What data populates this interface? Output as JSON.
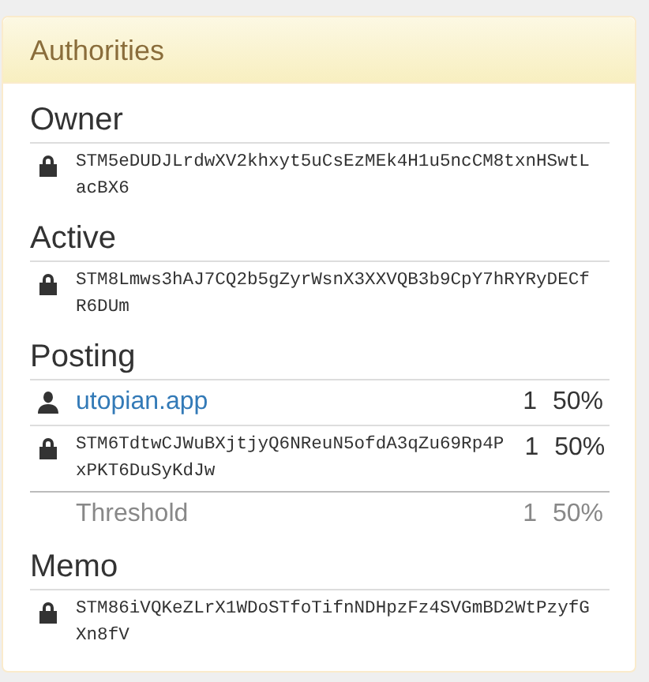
{
  "panel": {
    "title": "Authorities"
  },
  "sections": [
    {
      "title": "Owner",
      "entries": [
        {
          "kind": "key",
          "text": "STM5eDUDJLrdwXV2khxyt5uCsEzMEk4H1u5ncCM8txnHSwtLacBX6"
        }
      ]
    },
    {
      "title": "Active",
      "entries": [
        {
          "kind": "key",
          "text": "STM8Lmws3hAJ7CQ2b5gZyrWsnX3XXVQB3b9CpY7hRYRyDECfR6DUm"
        }
      ]
    },
    {
      "title": "Posting",
      "entries": [
        {
          "kind": "account",
          "text": "utopian.app",
          "weight": "1",
          "percent": "50%"
        },
        {
          "kind": "key",
          "text": "STM6TdtwCJWuBXjtjyQ6NReuN5ofdA3qZu69Rp4PxPKT6DuSyKdJw",
          "weight": "1",
          "percent": "50%"
        }
      ],
      "threshold": {
        "label": "Threshold",
        "weight": "1",
        "percent": "50%"
      }
    },
    {
      "title": "Memo",
      "entries": [
        {
          "kind": "key",
          "text": "STM86iVQKeZLrX1WDoSTfoTifnNDHpzFz4SVGmBD2WtPzyfGXn8fV"
        }
      ]
    }
  ]
}
